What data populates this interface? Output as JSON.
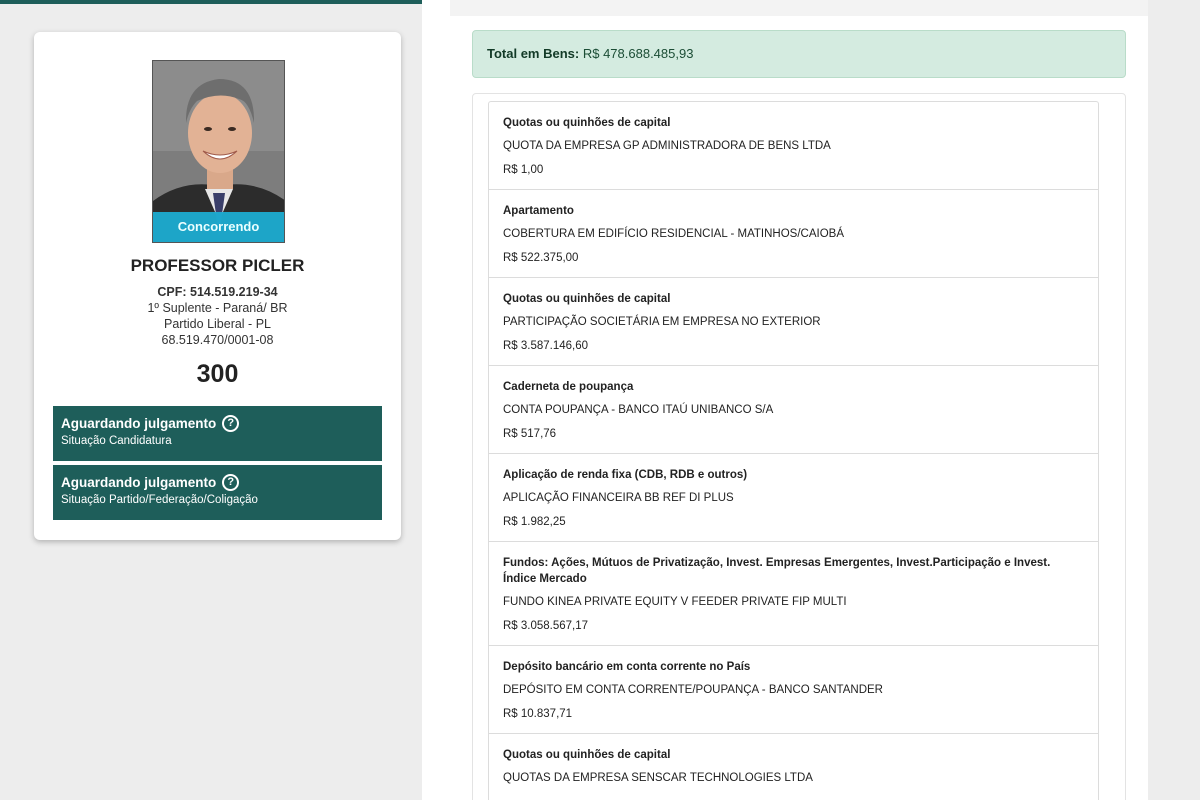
{
  "candidate": {
    "photo_badge": "Concorrendo",
    "name": "PROFESSOR PICLER",
    "cpf": "CPF: 514.519.219-34",
    "role": "1º Suplente - Paraná/ BR",
    "party": "Partido Liberal - PL",
    "cnpj": "68.519.470/0001-08",
    "number": "300",
    "status": [
      {
        "title": "Aguardando julgamento",
        "subtitle": "Situação Candidatura",
        "icon": "help-circle-icon"
      },
      {
        "title": "Aguardando julgamento",
        "subtitle": "Situação Partido/Federação/Coligação",
        "icon": "help-circle-icon"
      }
    ]
  },
  "assets": {
    "total_label": "Total em Bens:",
    "total_value": "R$ 478.688.485,93",
    "items": [
      {
        "type": "Quotas ou quinhões de capital",
        "description": "QUOTA DA EMPRESA GP ADMINISTRADORA DE BENS LTDA",
        "value": "R$ 1,00"
      },
      {
        "type": "Apartamento",
        "description": "COBERTURA EM EDIFÍCIO RESIDENCIAL - MATINHOS/CAIOBÁ",
        "value": "R$ 522.375,00"
      },
      {
        "type": "Quotas ou quinhões de capital",
        "description": "PARTICIPAÇÃO SOCIETÁRIA EM EMPRESA NO EXTERIOR",
        "value": "R$ 3.587.146,60"
      },
      {
        "type": "Caderneta de poupança",
        "description": "CONTA POUPANÇA - BANCO ITAÚ UNIBANCO S/A",
        "value": "R$ 517,76"
      },
      {
        "type": "Aplicação de renda fixa (CDB, RDB e outros)",
        "description": "APLICAÇÃO FINANCEIRA BB REF DI PLUS",
        "value": "R$ 1.982,25"
      },
      {
        "type": "Fundos: Ações, Mútuos de Privatização, Invest. Empresas Emergentes, Invest.Participação e Invest. Índice Mercado",
        "description": "FUNDO KINEA PRIVATE EQUITY V FEEDER PRIVATE FIP MULTI",
        "value": "R$ 3.058.567,17"
      },
      {
        "type": "Depósito bancário em conta corrente no País",
        "description": "DEPÓSITO EM CONTA CORRENTE/POUPANÇA - BANCO SANTANDER",
        "value": "R$ 10.837,71"
      },
      {
        "type": "Quotas ou quinhões de capital",
        "description": "QUOTAS DA EMPRESA SENSCAR TECHNOLOGIES LTDA",
        "value": ""
      }
    ]
  },
  "colors": {
    "accent_dark_teal": "#1e5e5a",
    "badge_cyan": "#1cb0d6",
    "total_bg": "#d4ebe0"
  }
}
